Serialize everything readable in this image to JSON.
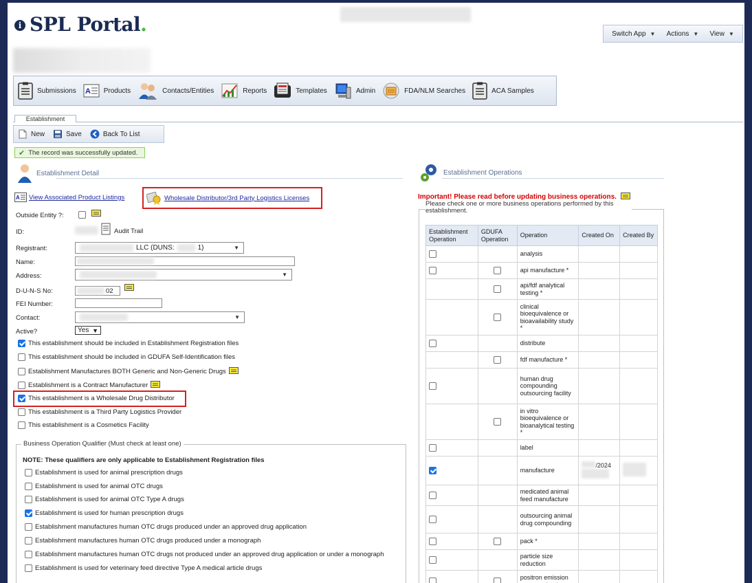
{
  "app": {
    "brand": "SPL Portal",
    "brand_dot": "."
  },
  "top_menu": [
    {
      "label": "Switch App"
    },
    {
      "label": "Actions"
    },
    {
      "label": "View"
    }
  ],
  "nav": [
    {
      "label": "Submissions",
      "icon": "clipboard-icon"
    },
    {
      "label": "Products",
      "icon": "product-list-icon"
    },
    {
      "label": "Contacts/Entities",
      "icon": "people-icon"
    },
    {
      "label": "Reports",
      "icon": "chart-icon"
    },
    {
      "label": "Templates",
      "icon": "templates-icon"
    },
    {
      "label": "Admin",
      "icon": "computer-icon"
    },
    {
      "label": "FDA/NLM Searches",
      "icon": "search-doc-icon"
    },
    {
      "label": "ACA Samples",
      "icon": "clipboard-icon"
    }
  ],
  "tab": {
    "label": "Establishment"
  },
  "toolbar": {
    "new": "New",
    "save": "Save",
    "back": "Back To List"
  },
  "status": {
    "message": "The record was successfully updated."
  },
  "detail": {
    "title": "Establishment Detail",
    "view_listings": "View Associated Product Listings",
    "wholesale_link": "Wholesale Distributor/3rd Party Logistics Licenses",
    "outside_entity_label": "Outside Entity ?:",
    "id_label": "ID:",
    "audit_trail": "Audit Trail",
    "registrant_label": "Registrant:",
    "registrant_value": "LLC (DUNS:",
    "registrant_suffix": "1)",
    "name_label": "Name:",
    "address_label": "Address:",
    "duns_label": "D-U-N-S No:",
    "duns_value": "02",
    "fei_label": "FEI Number:",
    "contact_label": "Contact:",
    "active_label": "Active?",
    "active_value": "Yes"
  },
  "checks": [
    {
      "label": "This establishment should be included in Establishment Registration files",
      "checked": true
    },
    {
      "label": "This establishment should be included in GDUFA Self-Identification files",
      "checked": false
    },
    {
      "label": "Establishment Manufactures BOTH Generic and Non-Generic Drugs",
      "checked": false
    },
    {
      "label": "Establishment is a Contract Manufacturer",
      "checked": false
    },
    {
      "label": "This establishment is a Wholesale Drug Distributor",
      "checked": true
    },
    {
      "label": "This establishment is a Third Party Logistics Provider",
      "checked": false
    },
    {
      "label": "This establishment is a Cosmetics Facility",
      "checked": false
    }
  ],
  "qualifiers": {
    "legend": "Business Operation Qualifier (Must check at least one)",
    "note": "NOTE: These qualifiers are only applicable to Establishment Registration files",
    "items": [
      {
        "label": "Establishment is used for animal prescription drugs",
        "checked": false
      },
      {
        "label": "Establishment is used for animal OTC drugs",
        "checked": false
      },
      {
        "label": "Establishment is used for animal OTC Type A drugs",
        "checked": false
      },
      {
        "label": "Establishment is used for human prescription drugs",
        "checked": true
      },
      {
        "label": "Establishment manufactures human OTC drugs produced under an approved drug application",
        "checked": false
      },
      {
        "label": "Establishment manufactures human OTC drugs produced under a monograph",
        "checked": false
      },
      {
        "label": "Establishment manufactures human OTC drugs not produced under an approved drug application or under a monograph",
        "checked": false
      },
      {
        "label": "Establishment is used for veterinary feed directive Type A medical article drugs",
        "checked": false
      }
    ]
  },
  "operations": {
    "title": "Establishment Operations",
    "important": "Important! Please read before updating business operations.",
    "instruction": "Please check one or more business operations performed by this establishment.",
    "columns": [
      "Establishment Operation",
      "GDUFA Operation",
      "Operation",
      "Created On",
      "Created By"
    ],
    "rows": [
      {
        "est": false,
        "gdufa": null,
        "op": "analysis",
        "created_on": "",
        "created_by": ""
      },
      {
        "est": false,
        "gdufa": false,
        "op": "api manufacture *",
        "created_on": "",
        "created_by": ""
      },
      {
        "est": null,
        "gdufa": false,
        "op": "api/fdf analytical testing *",
        "created_on": "",
        "created_by": ""
      },
      {
        "est": null,
        "gdufa": false,
        "op": "clinical bioequivalence or bioavailability study *",
        "created_on": "",
        "created_by": ""
      },
      {
        "est": false,
        "gdufa": null,
        "op": "distribute",
        "created_on": "",
        "created_by": ""
      },
      {
        "est": null,
        "gdufa": false,
        "op": "fdf manufacture *",
        "created_on": "",
        "created_by": ""
      },
      {
        "est": false,
        "gdufa": null,
        "op": "human drug compounding outsourcing facility",
        "created_on": "",
        "created_by": ""
      },
      {
        "est": null,
        "gdufa": false,
        "op": "in vitro bioequivalence or bioanalytical testing *",
        "created_on": "",
        "created_by": ""
      },
      {
        "est": false,
        "gdufa": null,
        "op": "label",
        "created_on": "",
        "created_by": ""
      },
      {
        "est": true,
        "gdufa": null,
        "op": "manufacture",
        "created_on": "/2024",
        "created_by": ""
      },
      {
        "est": false,
        "gdufa": null,
        "op": "medicated animal feed manufacture",
        "created_on": "",
        "created_by": ""
      },
      {
        "est": false,
        "gdufa": null,
        "op": "outsourcing animal drug compounding",
        "created_on": "",
        "created_by": ""
      },
      {
        "est": false,
        "gdufa": false,
        "op": "pack *",
        "created_on": "",
        "created_by": ""
      },
      {
        "est": false,
        "gdufa": null,
        "op": "particle size reduction",
        "created_on": "",
        "created_by": ""
      },
      {
        "est": false,
        "gdufa": false,
        "op": "positron emission tomography drug",
        "created_on": "",
        "created_by": ""
      }
    ]
  }
}
